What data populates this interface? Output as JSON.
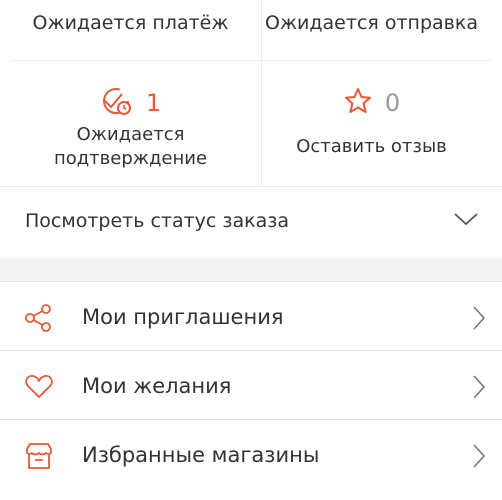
{
  "order_status": {
    "awaiting_payment_label": "Ожидается платёж",
    "awaiting_shipment_label": "Ожидается отправка",
    "awaiting_confirmation": {
      "count": "1",
      "label_line1": "Ожидается",
      "label_line2": "подтверждение",
      "icon": "clock-check-icon"
    },
    "leave_review": {
      "count": "0",
      "label": "Оставить отзыв",
      "icon": "star-icon"
    },
    "view_status_label": "Посмотреть статус заказа"
  },
  "menu": {
    "items": [
      {
        "label": "Мои приглашения",
        "icon": "share-icon"
      },
      {
        "label": "Мои желания",
        "icon": "heart-icon"
      },
      {
        "label": "Избранные магазины",
        "icon": "store-icon"
      }
    ]
  },
  "colors": {
    "accent": "#e8573a",
    "count_gray": "#999999",
    "divider": "#ececec",
    "band": "#f2f2f2"
  }
}
